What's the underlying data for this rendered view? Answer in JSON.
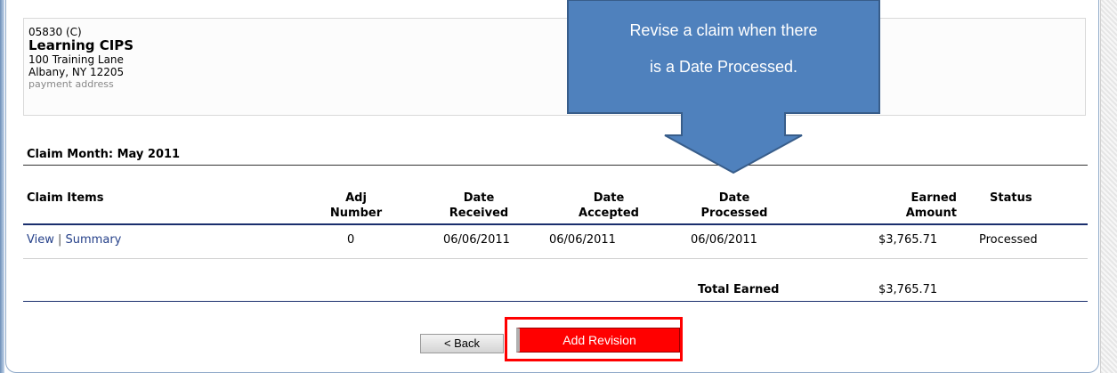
{
  "payee": {
    "code": "05830 (C)",
    "name": "Learning CIPS",
    "street": "100 Training Lane",
    "city": "Albany, NY 12205",
    "address_label": "payment address"
  },
  "claim_month": "Claim Month: May 2011",
  "table": {
    "headers": {
      "claim_items": "Claim Items",
      "adj_number": [
        "Adj",
        "Number"
      ],
      "date_received": [
        "Date",
        "Received"
      ],
      "date_accepted": [
        "Date",
        "Accepted"
      ],
      "date_processed": [
        "Date",
        "Processed"
      ],
      "earned_amount": [
        "Earned",
        "Amount"
      ],
      "status": "Status"
    },
    "row": {
      "view_link": "View",
      "separator": "|",
      "summary_link": "Summary",
      "adj_number": "0",
      "date_received": "06/06/2011",
      "date_accepted": "06/06/2011",
      "date_processed": "06/06/2011",
      "earned_amount": "$3,765.71",
      "status": "Processed"
    },
    "total_label": "Total Earned",
    "total_value": "$3,765.71"
  },
  "buttons": {
    "back": "< Back",
    "add_revision": "Add Revision"
  },
  "callout": {
    "line1": "Revise a claim when there",
    "line2": "is a Date Processed.",
    "fill_color": "#4f81bd",
    "border_color": "#385d8a"
  },
  "colors": {
    "highlight": "#ff0000",
    "link": "#26418a",
    "header_rule": "#1a2f6d"
  }
}
